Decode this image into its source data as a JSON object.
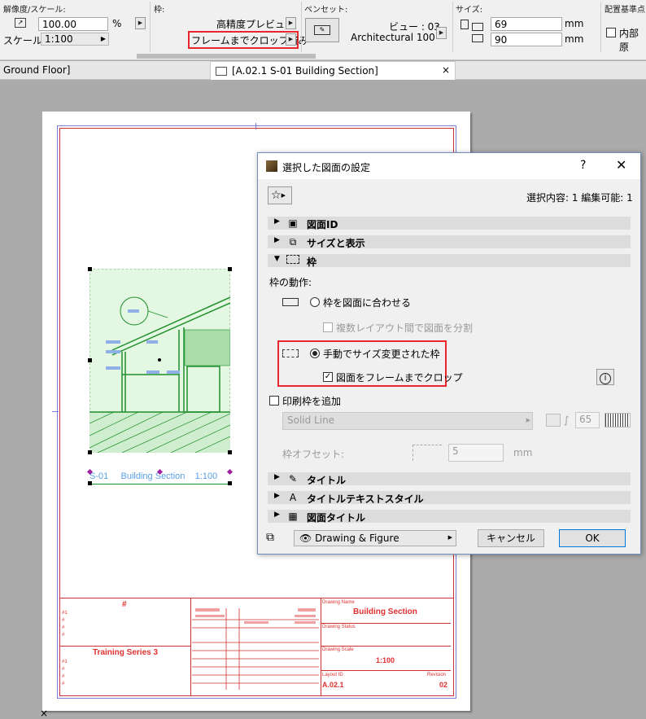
{
  "infobox": {
    "resolution_scale_label": "解像度/スケール:",
    "resolution_value": "100.00",
    "resolution_unit": "%",
    "scale_label": "スケール:",
    "scale_value": "1:100",
    "frame_label": "枠:",
    "preview_option": "高精度プレビュー",
    "crop_option": "フレームまでクロップ済み",
    "penset_label": "ペンセット:",
    "view_value": "ビュー : 03",
    "penset_name": "Architectural 100",
    "size_label": "サイズ:",
    "width_value": "69",
    "height_value": "90",
    "size_unit_w": "mm",
    "size_unit_h": "mm",
    "anchor_label": "配置基準点",
    "inner_origin_label": "内部原"
  },
  "tabs": {
    "left_tab": "Ground Floor]",
    "active_tab": "[A.02.1 S-01 Building Section]",
    "close": "×"
  },
  "sheet": {
    "drawing_title": "S-01",
    "drawing_title_name": "Building Section",
    "drawing_title_scale": "1:100",
    "titleblock": {
      "hash": "#",
      "hash_rows": [
        "#1",
        "#",
        "#",
        "#"
      ],
      "hash_rows2": [
        "#1",
        "#",
        "#",
        "#"
      ],
      "series": "Training Series 3",
      "drawing_name_label": "Drawing Name",
      "drawing_name": "Building Section",
      "drawing_status_label": "Drawing Status",
      "drawing_scale_label": "Drawing Scale",
      "drawing_scale": "1:100",
      "layout_id_label": "Layout ID",
      "layout_id": "A.02.1",
      "revision_label": "Revision",
      "revision": "02"
    },
    "corner_close": "×"
  },
  "dialog": {
    "title": "選択した図面の設定",
    "help": "?",
    "close": "✕",
    "selection_info": "選択内容: 1 編集可能: 1",
    "groups": {
      "drawing_id": "図面ID",
      "size_display": "サイズと表示",
      "frame": "枠",
      "title": "タイトル",
      "title_text_style": "タイトルテキストスタイル",
      "drawing_title": "図面タイトル"
    },
    "frame_behavior_label": "枠の動作:",
    "fit_frame_option": "枠を図面に合わせる",
    "split_option": "複数レイアウト間で図面を分割",
    "manual_frame_option": "手動でサイズ変更された枠",
    "crop_to_frame_option": "図面をフレームまでクロップ",
    "add_print_frame": "印刷枠を追加",
    "line_type": "Solid Line",
    "pen_value": "65",
    "frame_offset_label": "枠オフセット:",
    "frame_offset_value": "5",
    "frame_offset_unit": "mm",
    "layer_value": "Drawing & Figure",
    "cancel": "キャンセル",
    "ok": "OK"
  },
  "colors": {
    "highlight_red": "#e8262b",
    "drawing_green": "#1f8f2a",
    "titleblock_red": "#e03030"
  }
}
